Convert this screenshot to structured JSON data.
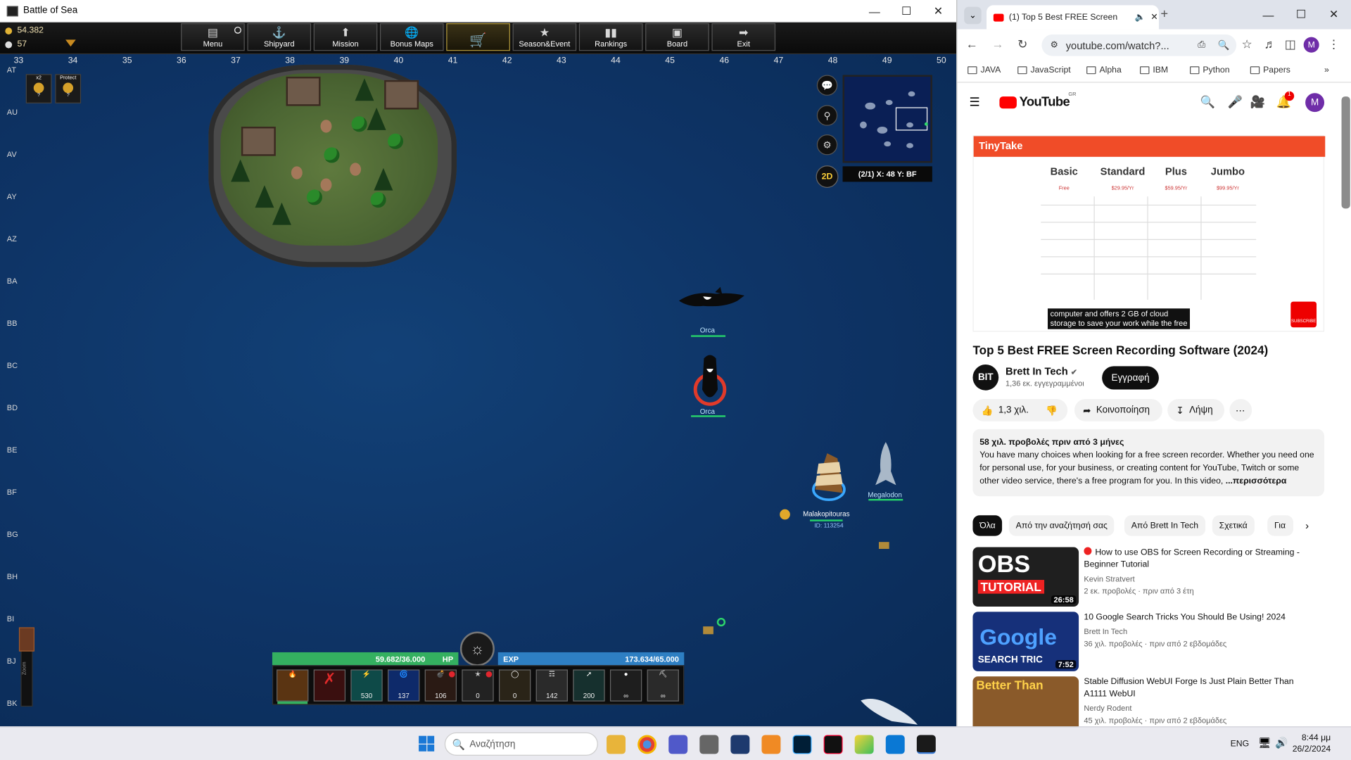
{
  "game": {
    "window_title": "Battle of Sea",
    "gold": "54.382",
    "pearls": "57",
    "menu": [
      {
        "label": "Menu",
        "icon": "menu-icon"
      },
      {
        "label": "Shipyard",
        "icon": "anchor-icon"
      },
      {
        "label": "Mission",
        "icon": "arrow-up-icon"
      },
      {
        "label": "Bonus Maps",
        "icon": "globe-icon"
      },
      {
        "label": "",
        "icon": "basket-icon"
      },
      {
        "label": "Season&Event",
        "icon": "star-icon"
      },
      {
        "label": "Rankings",
        "icon": "bar-chart-icon"
      },
      {
        "label": "Board",
        "icon": "board-icon"
      },
      {
        "label": "Exit",
        "icon": "arrow-right-icon"
      }
    ],
    "columns": [
      "33",
      "34",
      "35",
      "36",
      "37",
      "38",
      "39",
      "40",
      "41",
      "42",
      "43",
      "44",
      "45",
      "46",
      "47",
      "48",
      "49",
      "50"
    ],
    "rows": [
      "AT",
      "AU",
      "AV",
      "AY",
      "AZ",
      "BA",
      "BB",
      "BC",
      "BD",
      "BE",
      "BF",
      "BG",
      "BH",
      "BI",
      "BJ",
      "BK"
    ],
    "buffs": [
      {
        "label": "x2",
        "icon": "coin-icon",
        "badge": "?"
      },
      {
        "label": "Protect",
        "icon": "shield-icon",
        "badge": "?"
      }
    ],
    "coordinates": "(2/1) X: 48 Y: BF",
    "view_mode": "2D",
    "creatures": [
      {
        "name": "Orca"
      },
      {
        "name": "Orca"
      },
      {
        "name": "Megalodon"
      }
    ],
    "player": {
      "name": "Malakopitouras",
      "id": "ID: 113254"
    },
    "hp": {
      "label": "HP",
      "value": "59.682/36.000"
    },
    "exp": {
      "label": "EXP",
      "value": "173.634/65.000"
    },
    "zoom_label": "Zoom",
    "skills": [
      {
        "count": "",
        "icon": "fire-icon"
      },
      {
        "count": "",
        "icon": "slash-icon"
      },
      {
        "count": "530",
        "icon": "lightning-icon"
      },
      {
        "count": "137",
        "icon": "vortex-icon"
      },
      {
        "count": "106",
        "icon": "bomb-icon"
      },
      {
        "count": "0",
        "icon": "cannon-icon"
      },
      {
        "count": "0",
        "icon": "barrel-icon"
      },
      {
        "count": "142",
        "icon": "jellyfish-icon"
      },
      {
        "count": "200",
        "icon": "spear-icon"
      },
      {
        "count": "∞",
        "icon": "cannonball-icon"
      },
      {
        "count": "∞",
        "icon": "gun-icon"
      }
    ]
  },
  "chrome": {
    "tab_title": "(1) Top 5 Best FREE Screen",
    "url": "youtube.com/watch?...",
    "bookmarks": [
      "JAVA",
      "JavaScript",
      "Alpha",
      "IBM",
      "Python",
      "Papers"
    ],
    "yt_logo": "YouTube",
    "yt_region": "GR",
    "notif_count": "1",
    "avatar_letter": "M",
    "video": {
      "brand": "TinyTake",
      "plans": [
        "Basic",
        "Standard",
        "Plus",
        "Jumbo"
      ],
      "plan_prices": [
        "Free",
        "$29.95/Yr",
        "$59.95/Yr",
        "$99.95/Yr"
      ],
      "caption_1": "computer and offers 2 GB of cloud",
      "caption_2": "storage to save your work while the free",
      "subscribe_badge": "SUBSCRIBE"
    },
    "title": "Top 5 Best FREE Screen Recording Software (2024)",
    "channel": {
      "avatar": "BIT",
      "name": "Brett In Tech",
      "subs": "1,36 εκ. εγγεγραμμένοι"
    },
    "subscribe": "Εγγραφή",
    "likes": "1,3 χιλ.",
    "share": "Κοινοποίηση",
    "download": "Λήψη",
    "description": {
      "meta": "58 χιλ. προβολές  πριν από 3 μήνες",
      "text": "You have many choices when looking for a free screen recorder. Whether you need one for personal use, for your business, or creating content for YouTube, Twitch or some other video service, there's a free program for you. In this video,",
      "more": "...περισσότερα"
    },
    "chips": [
      "Όλα",
      "Από την αναζήτησή σας",
      "Από Brett In Tech",
      "Σχετικά",
      "Για"
    ],
    "recommendations": [
      {
        "thumb_text": "OBS",
        "thumb_sub": "TUTORIAL",
        "duration": "26:58",
        "title": "How to use OBS for Screen Recording or Streaming - Beginner Tutorial",
        "channel": "Kevin Stratvert",
        "meta": "2 εκ. προβολές  · πριν από 3 έτη",
        "thumb_color": "#1f1f1f"
      },
      {
        "thumb_text": "Google",
        "thumb_sub": "SEARCH TRIC",
        "duration": "7:52",
        "title": "10 Google Search Tricks You Should Be Using! 2024",
        "channel": "Brett In Tech",
        "meta": "36 χιλ. προβολές  · πριν από 2 εβδομάδες",
        "thumb_color": "#16307a"
      },
      {
        "thumb_text": "Better Than",
        "thumb_sub": "",
        "duration": "",
        "title": "Stable Diffusion WebUI Forge Is Just Plain Better Than A1111 WebUI",
        "channel": "Nerdy Rodent",
        "meta": "45 χιλ. προβολές  · πριν από 2 εβδομάδες",
        "thumb_color": "#8a5a2a"
      }
    ]
  },
  "taskbar": {
    "search_placeholder": "Αναζήτηση",
    "lang": "ENG",
    "time": "8:44 μμ",
    "date": "26/2/2024"
  },
  "colors": {
    "hp": "#34b060",
    "exp": "#2e7fc3",
    "sea": "#0e3466",
    "accent_yt": "#ff0000"
  }
}
